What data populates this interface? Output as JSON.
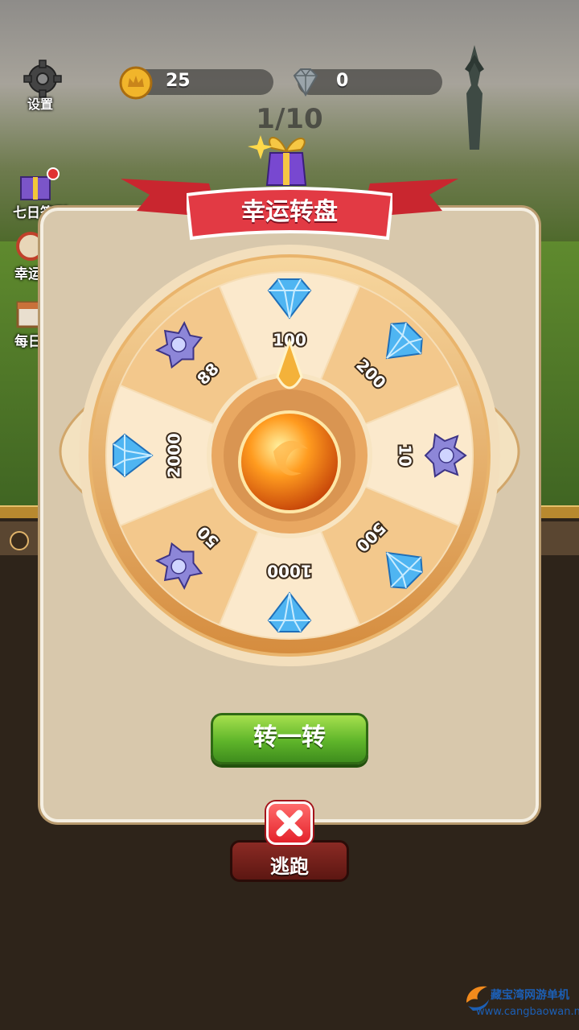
{
  "hud": {
    "settings_label": "设置",
    "coins": "25",
    "gems": "0",
    "wave_counter": "1/10"
  },
  "side_menu": [
    {
      "label": "七日签到"
    },
    {
      "label": "幸运"
    },
    {
      "label": "每日"
    }
  ],
  "wheel": {
    "title": "幸运转盘",
    "segments": [
      {
        "value": "100",
        "prize": "diamond"
      },
      {
        "value": "200",
        "prize": "diamond"
      },
      {
        "value": "10",
        "prize": "crystal"
      },
      {
        "value": "500",
        "prize": "diamond"
      },
      {
        "value": "1000",
        "prize": "diamond"
      },
      {
        "value": "50",
        "prize": "crystal"
      },
      {
        "value": "2000",
        "prize": "diamond"
      },
      {
        "value": "88",
        "prize": "crystal"
      }
    ]
  },
  "buttons": {
    "spin": "转一转",
    "flee": "逃跑"
  },
  "watermark": {
    "name": "藏宝湾网游单机",
    "url": "www.cangbaowan.net"
  },
  "colors": {
    "ribbon": "#e23a44",
    "spin_button": "#5fb52a",
    "close_button": "#e4222b",
    "panel": "#d8c8ac"
  }
}
